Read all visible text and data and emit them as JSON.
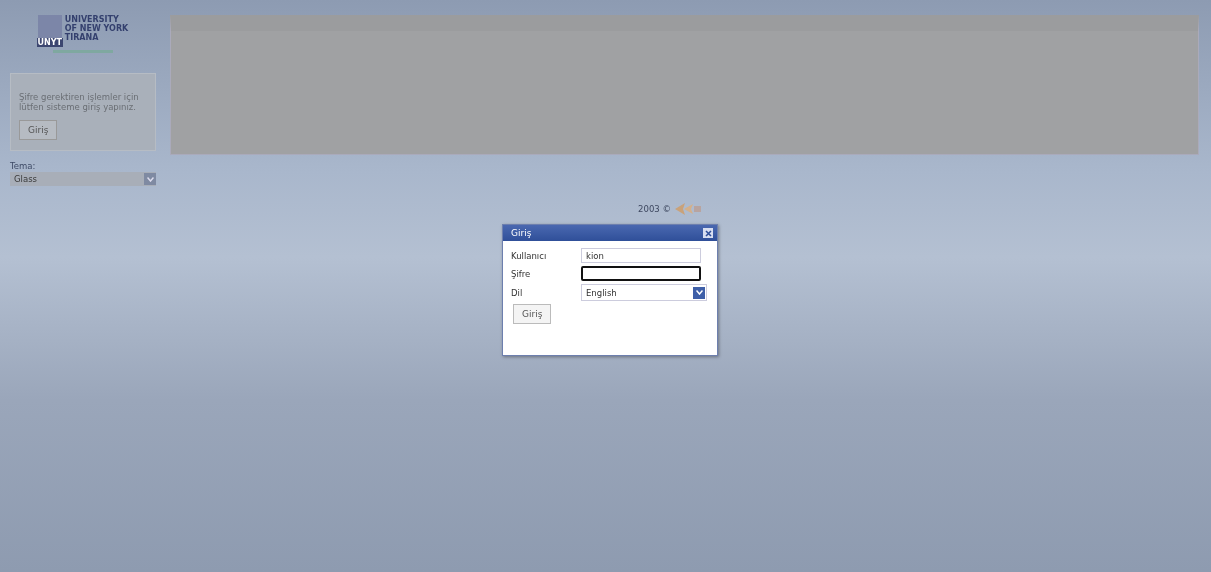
{
  "logo": {
    "lines": [
      "UNIVERSITY",
      "OF NEW YORK",
      "TIRANA"
    ],
    "badge": "UNYT"
  },
  "login_box": {
    "message": "Şifre gerektiren işlemler için lütfen sisteme giriş yapınız.",
    "button": "Giriş"
  },
  "theme": {
    "label": "Tema:",
    "value": "Glass"
  },
  "footer": {
    "text": "2003 ©"
  },
  "dialog": {
    "title": "Giriş",
    "fields": [
      {
        "kind": "text",
        "label": "Kullanıcı",
        "value": "kion",
        "focused": false
      },
      {
        "kind": "password",
        "label": "Şifre",
        "focused": true
      },
      {
        "kind": "select",
        "label": "Dil",
        "value": "English",
        "focused": false
      }
    ],
    "button": "Giriş"
  }
}
